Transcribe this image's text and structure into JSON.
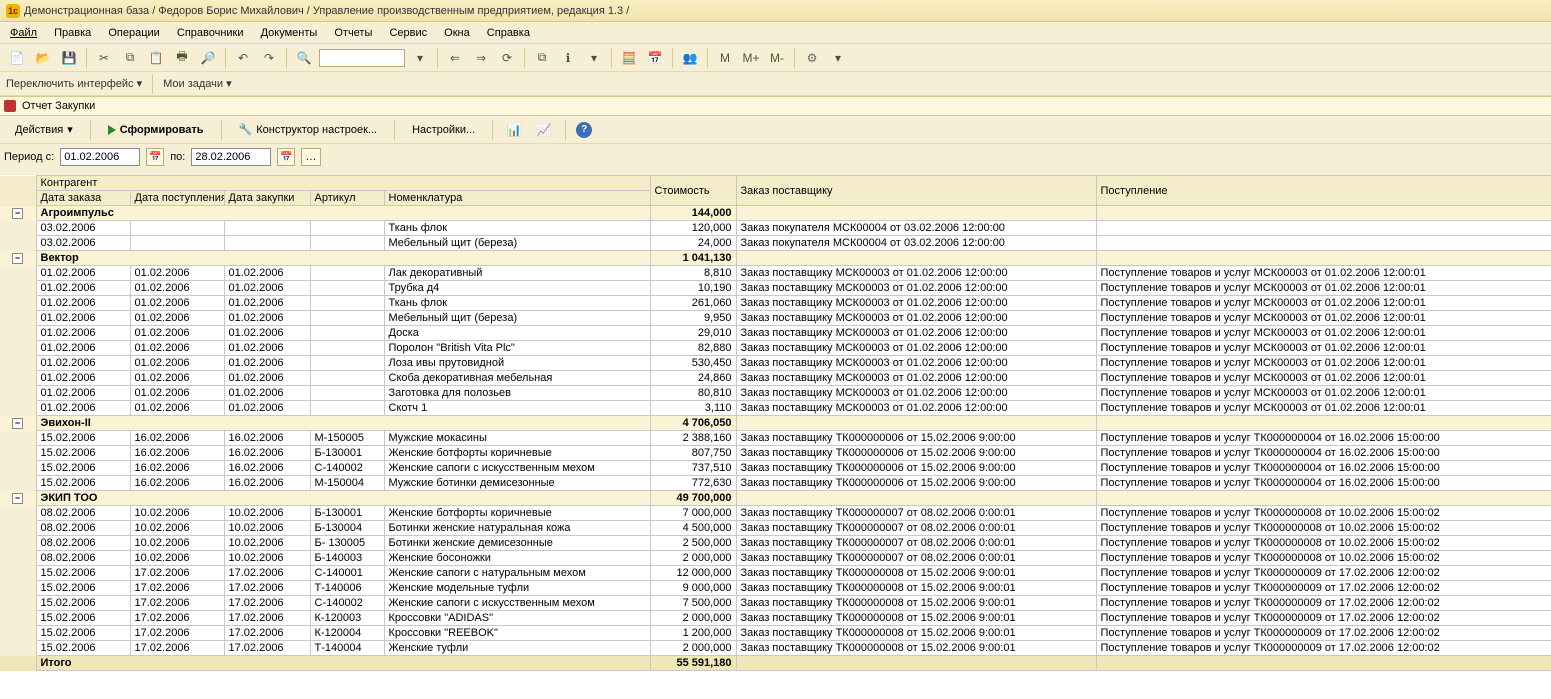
{
  "title": "Демонстрационная база / Федоров Борис Михайлович / Управление производственным предприятием, редакция 1.3 /",
  "menu": {
    "file": "Файл",
    "edit": "Правка",
    "ops": "Операции",
    "refs": "Справочники",
    "docs": "Документы",
    "reps": "Отчеты",
    "svc": "Сервис",
    "win": "Окна",
    "help": "Справка"
  },
  "toolbar2": {
    "switch": "Переключить интерфейс",
    "tasks": "Мои задачи"
  },
  "report": {
    "tab": "Отчет  Закупки",
    "actions": "Действия",
    "form": "Сформировать",
    "builder": "Конструктор настроек...",
    "settings": "Настройки..."
  },
  "period": {
    "label_from": "Период с:",
    "from": "01.02.2006",
    "label_to": "по:",
    "to": "28.02.2006"
  },
  "headers": {
    "contr": "Контрагент",
    "d1": "Дата заказа",
    "d2": "Дата поступления",
    "d3": "Дата закупки",
    "art": "Артикул",
    "nom": "Номенклатура",
    "cost": "Стоимость",
    "zak": "Заказ поставщику",
    "post": "Поступление"
  },
  "groups": [
    {
      "name": "Агроимпульс",
      "cost": "144,000",
      "rows": [
        {
          "d1": "03.02.2006",
          "nom": "Ткань флок",
          "cost": "120,000",
          "zak": "Заказ покупателя МСК00004 от 03.02.2006 12:00:00"
        },
        {
          "d1": "03.02.2006",
          "nom": "Мебельный щит (береза)",
          "cost": "24,000",
          "zak": "Заказ покупателя МСК00004 от 03.02.2006 12:00:00"
        }
      ]
    },
    {
      "name": "Вектор",
      "cost": "1 041,130",
      "rows": [
        {
          "d1": "01.02.2006",
          "d2": "01.02.2006",
          "d3": "01.02.2006",
          "nom": "Лак декоративный",
          "cost": "8,810",
          "zak": "Заказ поставщику МСК00003 от 01.02.2006 12:00:00",
          "post": "Поступление товаров и услуг МСК00003 от 01.02.2006 12:00:01"
        },
        {
          "d1": "01.02.2006",
          "d2": "01.02.2006",
          "d3": "01.02.2006",
          "nom": "Трубка д4",
          "cost": "10,190",
          "zak": "Заказ поставщику МСК00003 от 01.02.2006 12:00:00",
          "post": "Поступление товаров и услуг МСК00003 от 01.02.2006 12:00:01"
        },
        {
          "d1": "01.02.2006",
          "d2": "01.02.2006",
          "d3": "01.02.2006",
          "nom": "Ткань флок",
          "cost": "261,060",
          "zak": "Заказ поставщику МСК00003 от 01.02.2006 12:00:00",
          "post": "Поступление товаров и услуг МСК00003 от 01.02.2006 12:00:01"
        },
        {
          "d1": "01.02.2006",
          "d2": "01.02.2006",
          "d3": "01.02.2006",
          "nom": "Мебельный щит (береза)",
          "cost": "9,950",
          "zak": "Заказ поставщику МСК00003 от 01.02.2006 12:00:00",
          "post": "Поступление товаров и услуг МСК00003 от 01.02.2006 12:00:01"
        },
        {
          "d1": "01.02.2006",
          "d2": "01.02.2006",
          "d3": "01.02.2006",
          "nom": "Доска",
          "cost": "29,010",
          "zak": "Заказ поставщику МСК00003 от 01.02.2006 12:00:00",
          "post": "Поступление товаров и услуг МСК00003 от 01.02.2006 12:00:01"
        },
        {
          "d1": "01.02.2006",
          "d2": "01.02.2006",
          "d3": "01.02.2006",
          "nom": "Поролон \"British Vita Plc\"",
          "cost": "82,880",
          "zak": "Заказ поставщику МСК00003 от 01.02.2006 12:00:00",
          "post": "Поступление товаров и услуг МСК00003 от 01.02.2006 12:00:01"
        },
        {
          "d1": "01.02.2006",
          "d2": "01.02.2006",
          "d3": "01.02.2006",
          "nom": "Лоза ивы прутовидной",
          "cost": "530,450",
          "zak": "Заказ поставщику МСК00003 от 01.02.2006 12:00:00",
          "post": "Поступление товаров и услуг МСК00003 от 01.02.2006 12:00:01"
        },
        {
          "d1": "01.02.2006",
          "d2": "01.02.2006",
          "d3": "01.02.2006",
          "nom": "Скоба декоративная мебельная",
          "cost": "24,860",
          "zak": "Заказ поставщику МСК00003 от 01.02.2006 12:00:00",
          "post": "Поступление товаров и услуг МСК00003 от 01.02.2006 12:00:01"
        },
        {
          "d1": "01.02.2006",
          "d2": "01.02.2006",
          "d3": "01.02.2006",
          "nom": "Заготовка для полозьев",
          "cost": "80,810",
          "zak": "Заказ поставщику МСК00003 от 01.02.2006 12:00:00",
          "post": "Поступление товаров и услуг МСК00003 от 01.02.2006 12:00:01"
        },
        {
          "d1": "01.02.2006",
          "d2": "01.02.2006",
          "d3": "01.02.2006",
          "nom": "Скотч 1",
          "cost": "3,110",
          "zak": "Заказ поставщику МСК00003 от 01.02.2006 12:00:00",
          "post": "Поступление товаров и услуг МСК00003 от 01.02.2006 12:00:01"
        }
      ]
    },
    {
      "name": "Эвихон-II",
      "cost": "4 706,050",
      "rows": [
        {
          "d1": "15.02.2006",
          "d2": "16.02.2006",
          "d3": "16.02.2006",
          "art": "М-150005",
          "nom": "Мужские мокасины",
          "cost": "2 388,160",
          "zak": "Заказ поставщику ТК000000006 от 15.02.2006 9:00:00",
          "post": "Поступление товаров и услуг ТК000000004 от 16.02.2006 15:00:00"
        },
        {
          "d1": "15.02.2006",
          "d2": "16.02.2006",
          "d3": "16.02.2006",
          "art": "Б-130001",
          "nom": "Женские ботфорты коричневые",
          "cost": "807,750",
          "zak": "Заказ поставщику ТК000000006 от 15.02.2006 9:00:00",
          "post": "Поступление товаров и услуг ТК000000004 от 16.02.2006 15:00:00"
        },
        {
          "d1": "15.02.2006",
          "d2": "16.02.2006",
          "d3": "16.02.2006",
          "art": "С-140002",
          "nom": "Женские сапоги с искусственным мехом",
          "cost": "737,510",
          "zak": "Заказ поставщику ТК000000006 от 15.02.2006 9:00:00",
          "post": "Поступление товаров и услуг ТК000000004 от 16.02.2006 15:00:00"
        },
        {
          "d1": "15.02.2006",
          "d2": "16.02.2006",
          "d3": "16.02.2006",
          "art": "М-150004",
          "nom": "Мужские ботинки демисезонные",
          "cost": "772,630",
          "zak": "Заказ поставщику ТК000000006 от 15.02.2006 9:00:00",
          "post": "Поступление товаров и услуг ТК000000004 от 16.02.2006 15:00:00"
        }
      ]
    },
    {
      "name": "ЭКИП ТОО",
      "cost": "49 700,000",
      "rows": [
        {
          "d1": "08.02.2006",
          "d2": "10.02.2006",
          "d3": "10.02.2006",
          "art": "Б-130001",
          "nom": "Женские ботфорты коричневые",
          "cost": "7 000,000",
          "zak": "Заказ поставщику ТК000000007 от 08.02.2006 0:00:01",
          "post": "Поступление товаров и услуг ТК000000008 от 10.02.2006 15:00:02"
        },
        {
          "d1": "08.02.2006",
          "d2": "10.02.2006",
          "d3": "10.02.2006",
          "art": "Б-130004",
          "nom": "Ботинки женские натуральная кожа",
          "cost": "4 500,000",
          "zak": "Заказ поставщику ТК000000007 от 08.02.2006 0:00:01",
          "post": "Поступление товаров и услуг ТК000000008 от 10.02.2006 15:00:02"
        },
        {
          "d1": "08.02.2006",
          "d2": "10.02.2006",
          "d3": "10.02.2006",
          "art": "Б- 130005",
          "nom": "Ботинки женские демисезонные",
          "cost": "2 500,000",
          "zak": "Заказ поставщику ТК000000007 от 08.02.2006 0:00:01",
          "post": "Поступление товаров и услуг ТК000000008 от 10.02.2006 15:00:02"
        },
        {
          "d1": "08.02.2006",
          "d2": "10.02.2006",
          "d3": "10.02.2006",
          "art": "Б-140003",
          "nom": "Женские босоножки",
          "cost": "2 000,000",
          "zak": "Заказ поставщику ТК000000007 от 08.02.2006 0:00:01",
          "post": "Поступление товаров и услуг ТК000000008 от 10.02.2006 15:00:02"
        },
        {
          "d1": "15.02.2006",
          "d2": "17.02.2006",
          "d3": "17.02.2006",
          "art": "С-140001",
          "nom": "Женские сапоги с натуральным мехом",
          "cost": "12 000,000",
          "zak": "Заказ поставщику ТК000000008 от 15.02.2006 9:00:01",
          "post": "Поступление товаров и услуг ТК000000009 от 17.02.2006 12:00:02"
        },
        {
          "d1": "15.02.2006",
          "d2": "17.02.2006",
          "d3": "17.02.2006",
          "art": "Т-140006",
          "nom": "Женские модельные туфли",
          "cost": "9 000,000",
          "zak": "Заказ поставщику ТК000000008 от 15.02.2006 9:00:01",
          "post": "Поступление товаров и услуг ТК000000009 от 17.02.2006 12:00:02"
        },
        {
          "d1": "15.02.2006",
          "d2": "17.02.2006",
          "d3": "17.02.2006",
          "art": "С-140002",
          "nom": "Женские сапоги с искусственным мехом",
          "cost": "7 500,000",
          "zak": "Заказ поставщику ТК000000008 от 15.02.2006 9:00:01",
          "post": "Поступление товаров и услуг ТК000000009 от 17.02.2006 12:00:02"
        },
        {
          "d1": "15.02.2006",
          "d2": "17.02.2006",
          "d3": "17.02.2006",
          "art": "К-120003",
          "nom": "Кроссовки \"ADIDAS\"",
          "cost": "2 000,000",
          "zak": "Заказ поставщику ТК000000008 от 15.02.2006 9:00:01",
          "post": "Поступление товаров и услуг ТК000000009 от 17.02.2006 12:00:02"
        },
        {
          "d1": "15.02.2006",
          "d2": "17.02.2006",
          "d3": "17.02.2006",
          "art": "К-120004",
          "nom": "Кроссовки \"REEBOK\"",
          "cost": "1 200,000",
          "zak": "Заказ поставщику ТК000000008 от 15.02.2006 9:00:01",
          "post": "Поступление товаров и услуг ТК000000009 от 17.02.2006 12:00:02"
        },
        {
          "d1": "15.02.2006",
          "d2": "17.02.2006",
          "d3": "17.02.2006",
          "art": "Т-140004",
          "nom": "Женские туфли",
          "cost": "2 000,000",
          "zak": "Заказ поставщику ТК000000008 от 15.02.2006 9:00:01",
          "post": "Поступление товаров и услуг ТК000000009 от 17.02.2006 12:00:02"
        }
      ]
    }
  ],
  "total": {
    "label": "Итого",
    "cost": "55 591,180"
  }
}
